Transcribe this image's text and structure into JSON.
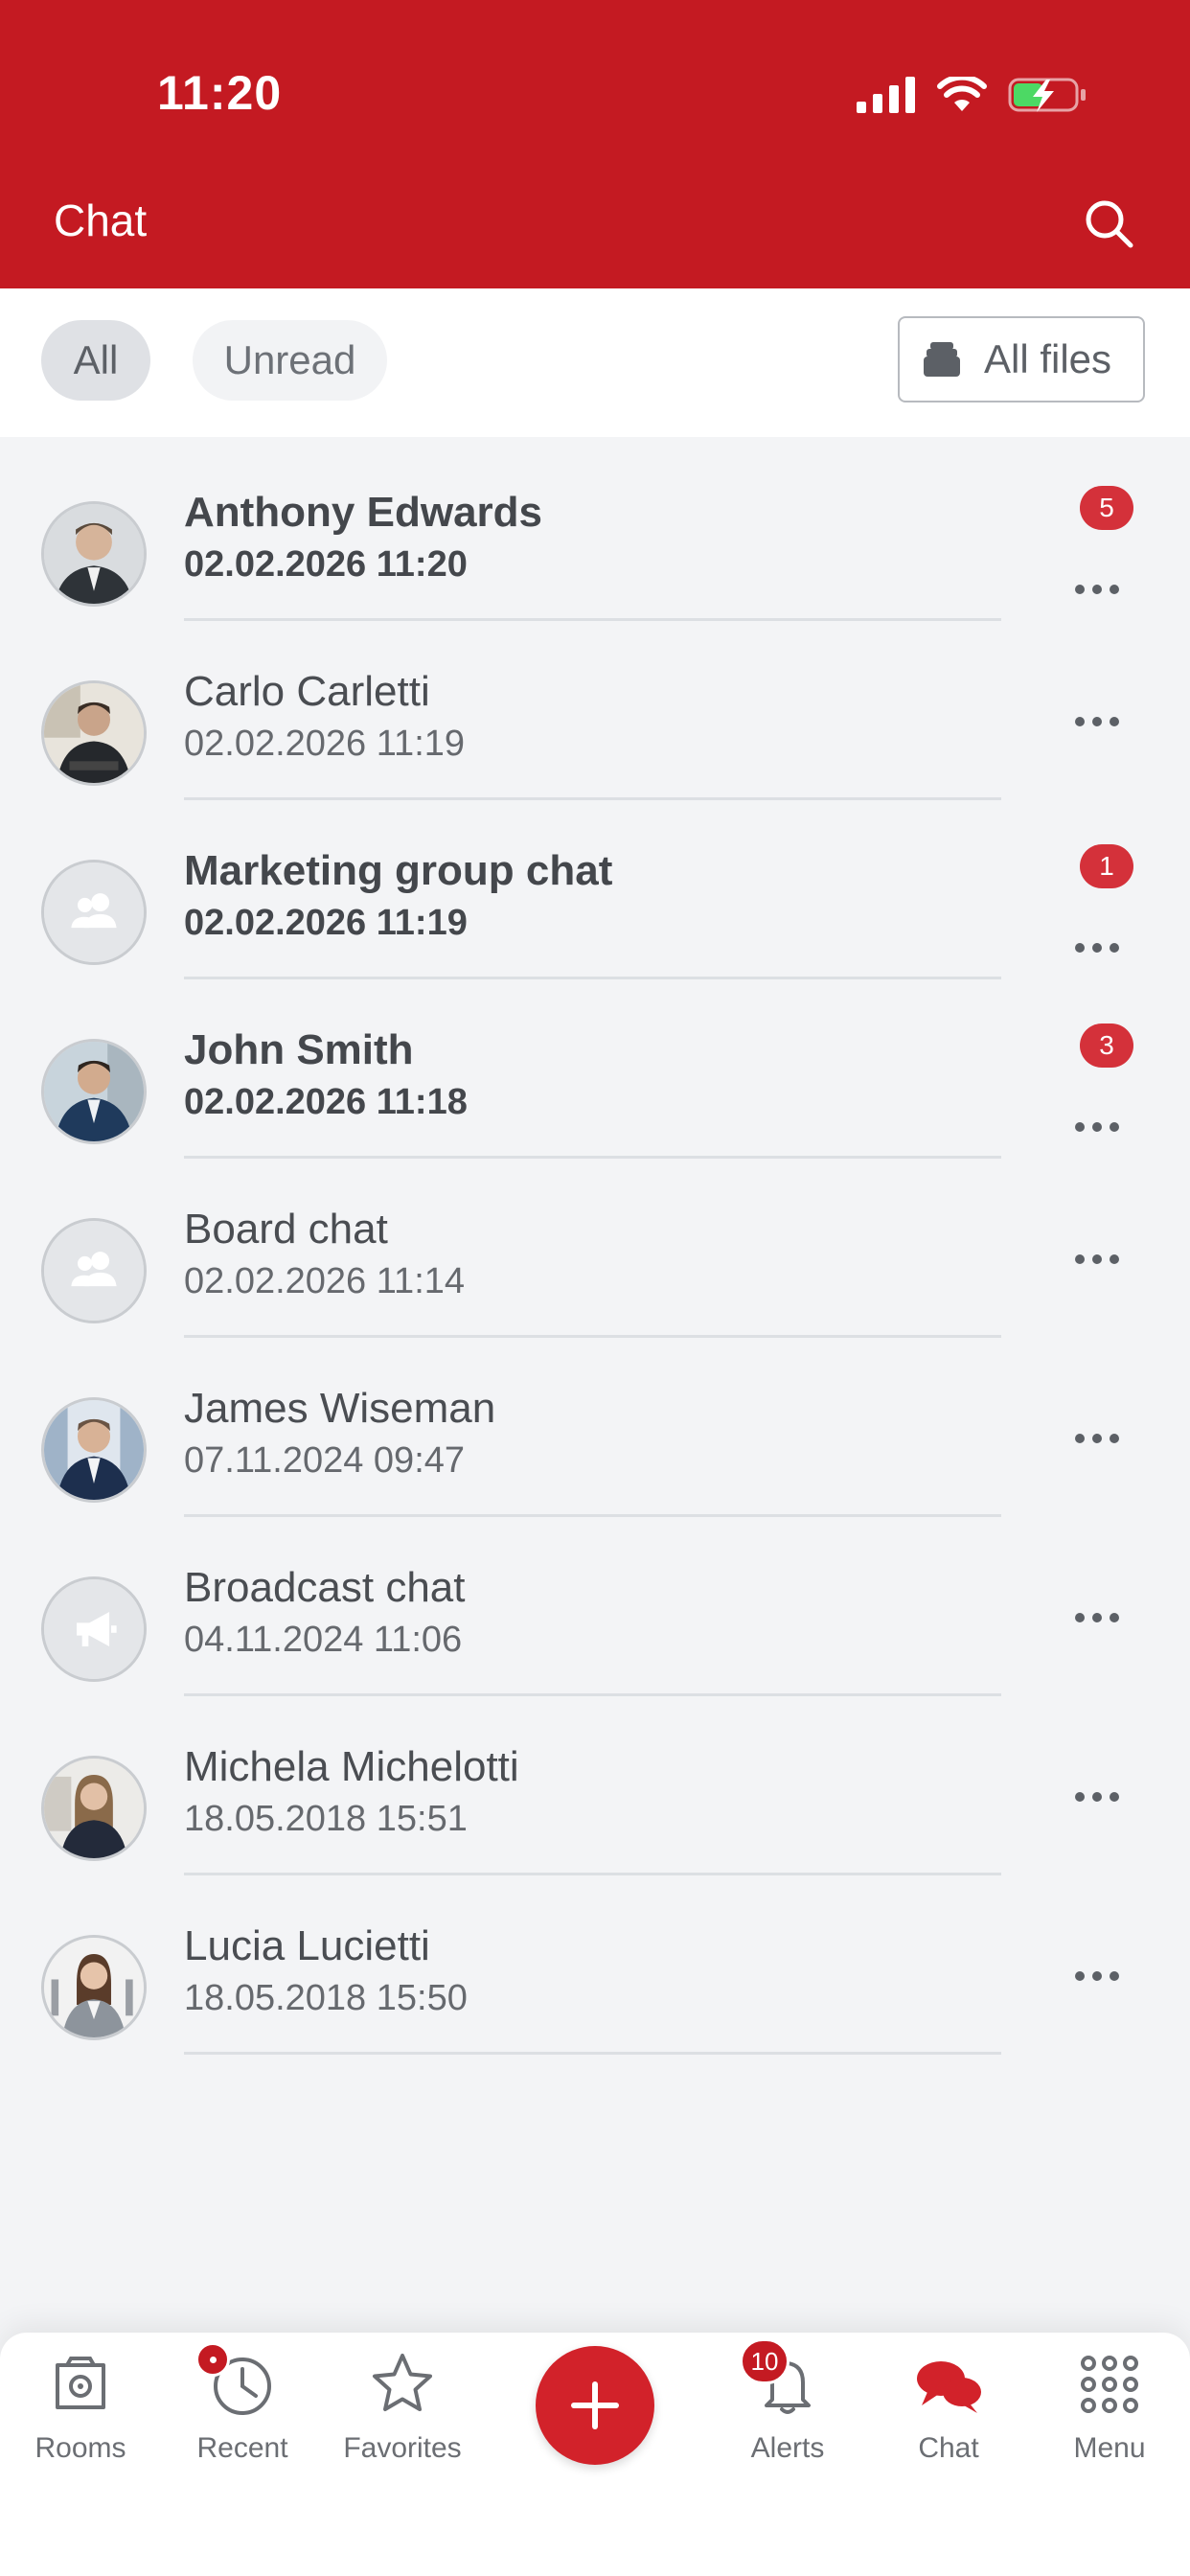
{
  "status_bar": {
    "time": "11:20"
  },
  "header": {
    "title": "Chat",
    "search_icon": "search-icon"
  },
  "filters": {
    "all": "All",
    "unread": "Unread",
    "all_files": "All files"
  },
  "chats": [
    {
      "name": "Anthony Edwards",
      "date": "02.02.2026 11:20",
      "unread": "5",
      "avatar": "photo"
    },
    {
      "name": "Carlo Carletti",
      "date": "02.02.2026 11:19",
      "unread": "",
      "avatar": "photo"
    },
    {
      "name": "Marketing group chat",
      "date": "02.02.2026 11:19",
      "unread": "1",
      "avatar": "group"
    },
    {
      "name": "John Smith",
      "date": "02.02.2026 11:18",
      "unread": "3",
      "avatar": "photo"
    },
    {
      "name": "Board chat",
      "date": "02.02.2026 11:14",
      "unread": "",
      "avatar": "group"
    },
    {
      "name": "James Wiseman",
      "date": "07.11.2024 09:47",
      "unread": "",
      "avatar": "photo"
    },
    {
      "name": "Broadcast chat",
      "date": "04.11.2024 11:06",
      "unread": "",
      "avatar": "broadcast"
    },
    {
      "name": "Michela Michelotti",
      "date": "18.05.2018 15:51",
      "unread": "",
      "avatar": "photo"
    },
    {
      "name": "Lucia Lucietti",
      "date": "18.05.2018 15:50",
      "unread": "",
      "avatar": "photo"
    }
  ],
  "bottom_nav": {
    "rooms": "Rooms",
    "recent": "Recent",
    "favorites": "Favorites",
    "alerts": "Alerts",
    "alerts_count": "10",
    "chat": "Chat",
    "menu": "Menu"
  },
  "colors": {
    "brand": "#c41a22",
    "badge": "#d4313a",
    "background": "#f3f4f6"
  }
}
